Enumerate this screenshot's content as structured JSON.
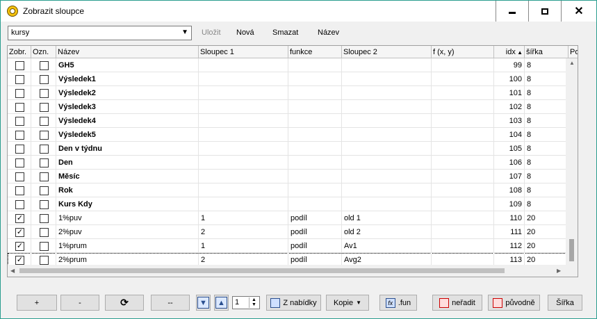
{
  "window": {
    "title": "Zobrazit sloupce"
  },
  "toolbar": {
    "combo_value": "kursy",
    "save_label": "Uložit",
    "new_label": "Nová",
    "delete_label": "Smazat",
    "name_label": "Název"
  },
  "columns": [
    "Zobr.",
    "Ozn.",
    "Název",
    "Sloupec 1",
    "funkce",
    "Sloupec 2",
    "f (x, y)",
    "idx",
    "šířka",
    "Po"
  ],
  "rows": [
    {
      "zobr": false,
      "ozn": false,
      "nazev": "GH5",
      "s1": "",
      "funkce": "",
      "s2": "",
      "fxy": "",
      "idx": "99",
      "sirka": "8",
      "bold": true
    },
    {
      "zobr": false,
      "ozn": false,
      "nazev": "Výsledek1",
      "s1": "",
      "funkce": "",
      "s2": "",
      "fxy": "",
      "idx": "100",
      "sirka": "8",
      "bold": true
    },
    {
      "zobr": false,
      "ozn": false,
      "nazev": "Výsledek2",
      "s1": "",
      "funkce": "",
      "s2": "",
      "fxy": "",
      "idx": "101",
      "sirka": "8",
      "bold": true
    },
    {
      "zobr": false,
      "ozn": false,
      "nazev": "Výsledek3",
      "s1": "",
      "funkce": "",
      "s2": "",
      "fxy": "",
      "idx": "102",
      "sirka": "8",
      "bold": true
    },
    {
      "zobr": false,
      "ozn": false,
      "nazev": "Výsledek4",
      "s1": "",
      "funkce": "",
      "s2": "",
      "fxy": "",
      "idx": "103",
      "sirka": "8",
      "bold": true
    },
    {
      "zobr": false,
      "ozn": false,
      "nazev": "Výsledek5",
      "s1": "",
      "funkce": "",
      "s2": "",
      "fxy": "",
      "idx": "104",
      "sirka": "8",
      "bold": true
    },
    {
      "zobr": false,
      "ozn": false,
      "nazev": "Den v týdnu",
      "s1": "",
      "funkce": "",
      "s2": "",
      "fxy": "",
      "idx": "105",
      "sirka": "8",
      "bold": true
    },
    {
      "zobr": false,
      "ozn": false,
      "nazev": "Den",
      "s1": "",
      "funkce": "",
      "s2": "",
      "fxy": "",
      "idx": "106",
      "sirka": "8",
      "bold": true
    },
    {
      "zobr": false,
      "ozn": false,
      "nazev": "Měsíc",
      "s1": "",
      "funkce": "",
      "s2": "",
      "fxy": "",
      "idx": "107",
      "sirka": "8",
      "bold": true
    },
    {
      "zobr": false,
      "ozn": false,
      "nazev": "Rok",
      "s1": "",
      "funkce": "",
      "s2": "",
      "fxy": "",
      "idx": "108",
      "sirka": "8",
      "bold": true
    },
    {
      "zobr": false,
      "ozn": false,
      "nazev": "Kurs Kdy",
      "s1": "",
      "funkce": "",
      "s2": "",
      "fxy": "",
      "idx": "109",
      "sirka": "8",
      "bold": true
    },
    {
      "zobr": true,
      "ozn": false,
      "nazev": "1%puv",
      "s1": "1",
      "funkce": "podíl",
      "s2": "old 1",
      "fxy": "",
      "idx": "110",
      "sirka": "20",
      "bold": false
    },
    {
      "zobr": true,
      "ozn": false,
      "nazev": "2%puv",
      "s1": "2",
      "funkce": "podíl",
      "s2": "old 2",
      "fxy": "",
      "idx": "111",
      "sirka": "20",
      "bold": false
    },
    {
      "zobr": true,
      "ozn": false,
      "nazev": "1%prum",
      "s1": "1",
      "funkce": "podíl",
      "s2": "Av1",
      "fxy": "",
      "idx": "112",
      "sirka": "20",
      "bold": false
    },
    {
      "zobr": true,
      "ozn": false,
      "nazev": "2%prum",
      "s1": "2",
      "funkce": "podíl",
      "s2": "Avg2",
      "fxy": "",
      "idx": "113",
      "sirka": "20",
      "bold": false
    }
  ],
  "selected_row": 14,
  "checkmark": "✓",
  "bottom": {
    "plus_label": "+",
    "minus_label": "-",
    "dash_label": "--",
    "spin_value": "1",
    "from_menu_label": "Z nabídky",
    "copy_label": "Kopie",
    "fun_label": ".fun",
    "unsort_label": "neřadit",
    "original_label": "původně",
    "width_label": "Šířka"
  }
}
